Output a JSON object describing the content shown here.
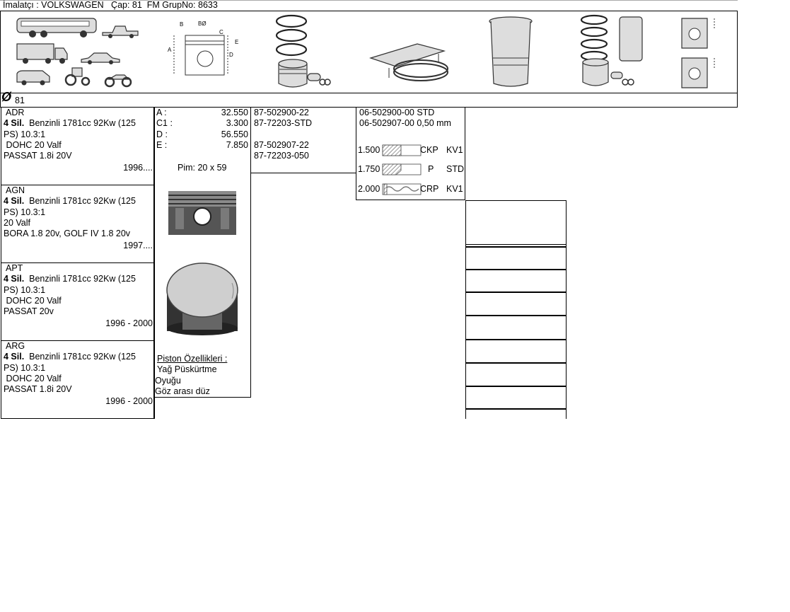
{
  "header": {
    "title": "İmalatçı : VOLKSWAGEN   Çap: 81  FM GrupNo: 8633"
  },
  "icons": [
    "bus-icon",
    "pickup-truck-icon",
    "truck-icon",
    "car-icon",
    "van-icon",
    "tractor-icon",
    "motorcycle-icon",
    "dimension-diagram-icon",
    "piston-rings-icon",
    "piston-pin-icon",
    "ring-compressor-icon",
    "cylinder-liner-icon",
    "piston-kit-icon",
    "piston-section-icon"
  ],
  "diameter": {
    "symbol": "Ø",
    "value": "81"
  },
  "engines": [
    {
      "code": "ADR",
      "cyl": "4 Sil.",
      "spec": "Benzinli 1781cc 92Kw (125",
      "spec2": "PS) 10.3:1",
      "valve": " DOHC 20 Valf",
      "model": "PASSAT 1.8i 20V",
      "years": "1996...."
    },
    {
      "code": "AGN",
      "cyl": "4 Sil.",
      "spec": "Benzinli 1781cc 92Kw (125",
      "spec2": "PS) 10.3:1",
      "valve": "20 Valf",
      "model": "BORA 1.8 20v, GOLF IV 1.8 20v",
      "years": "1997...."
    },
    {
      "code": "APT",
      "cyl": "4 Sil.",
      "spec": "Benzinli 1781cc 92Kw (125",
      "spec2": "PS) 10.3:1",
      "valve": " DOHC 20 Valf",
      "model": "PASSAT 20v",
      "years": "1996 - 2000"
    },
    {
      "code": "ARG",
      "cyl": "4 Sil.",
      "spec": "Benzinli 1781cc 92Kw (125",
      "spec2": "PS) 10.3:1",
      "valve": " DOHC 20 Valf",
      "model": "PASSAT 1.8i 20V",
      "years": "1996 - 2000"
    }
  ],
  "dimensions": [
    {
      "label": "A :",
      "value": "32.550"
    },
    {
      "label": "C1 :",
      "value": "3.300"
    },
    {
      "label": "D :",
      "value": "56.550"
    },
    {
      "label": "E :",
      "value": "7.850"
    }
  ],
  "pin": "Pim: 20 x 59",
  "features": {
    "title": "Piston Özellikleri :",
    "lines": [
      "Yağ Püskürtme",
      "Oyuğu",
      "Göz arası düz"
    ]
  },
  "part_numbers": [
    "87-502900-22",
    "87-72203-STD",
    "87-502907-22",
    "87-72203-050"
  ],
  "ring_sets": [
    "06-502900-00 STD",
    "06-502907-00 0,50 mm"
  ],
  "rings": [
    {
      "thickness": "1.500",
      "type": "CKP",
      "grade": "KV1"
    },
    {
      "thickness": "1.750",
      "type": "P",
      "grade": "STD"
    },
    {
      "thickness": "2.000",
      "type": "CRP",
      "grade": "KV1"
    }
  ]
}
